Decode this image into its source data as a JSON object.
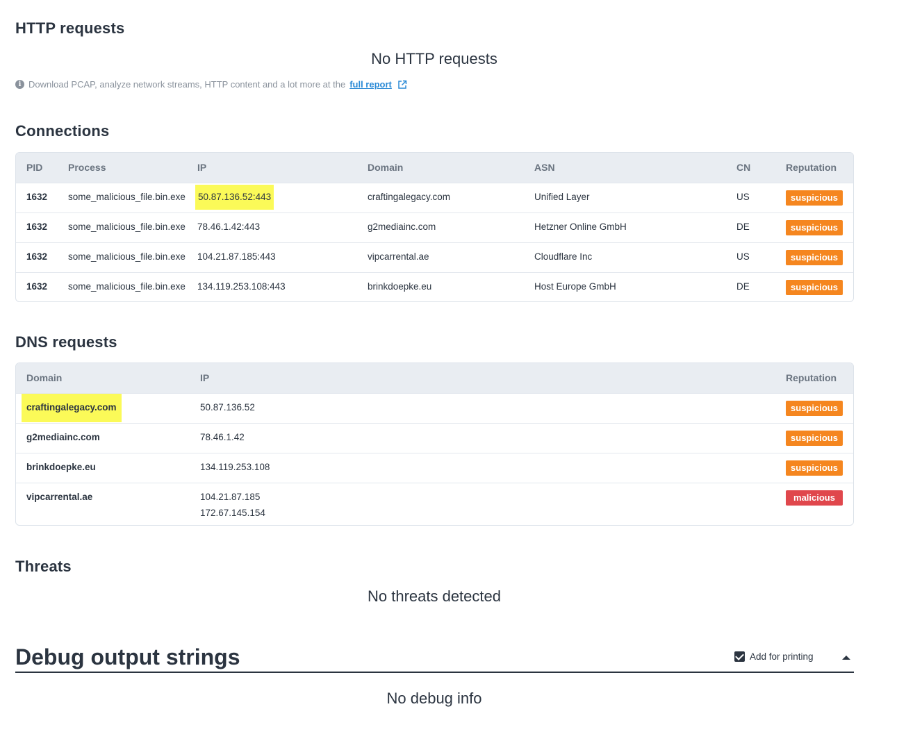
{
  "http": {
    "title": "HTTP requests",
    "empty": "No HTTP requests",
    "info_text": "Download PCAP, analyze network streams, HTTP content and a lot more at the",
    "link_text": "full report"
  },
  "connections": {
    "title": "Connections",
    "headers": [
      "PID",
      "Process",
      "IP",
      "Domain",
      "ASN",
      "CN",
      "Reputation"
    ],
    "rows": [
      {
        "pid": "1632",
        "process": "some_malicious_file.bin.exe",
        "ip": "50.87.136.52:443",
        "domain": "craftingalegacy.com",
        "asn": "Unified Layer",
        "cn": "US",
        "reputation": "suspicious"
      },
      {
        "pid": "1632",
        "process": "some_malicious_file.bin.exe",
        "ip": "78.46.1.42:443",
        "domain": "g2mediainc.com",
        "asn": "Hetzner Online GmbH",
        "cn": "DE",
        "reputation": "suspicious"
      },
      {
        "pid": "1632",
        "process": "some_malicious_file.bin.exe",
        "ip": "104.21.87.185:443",
        "domain": "vipcarrental.ae",
        "asn": "Cloudflare Inc",
        "cn": "US",
        "reputation": "suspicious"
      },
      {
        "pid": "1632",
        "process": "some_malicious_file.bin.exe",
        "ip": "134.119.253.108:443",
        "domain": "brinkdoepke.eu",
        "asn": "Host Europe GmbH",
        "cn": "DE",
        "reputation": "suspicious"
      }
    ]
  },
  "dns": {
    "title": "DNS requests",
    "headers": [
      "Domain",
      "IP",
      "Reputation"
    ],
    "rows": [
      {
        "domain": "craftingalegacy.com",
        "ips": [
          "50.87.136.52"
        ],
        "reputation": "suspicious"
      },
      {
        "domain": "g2mediainc.com",
        "ips": [
          "78.46.1.42"
        ],
        "reputation": "suspicious"
      },
      {
        "domain": "brinkdoepke.eu",
        "ips": [
          "134.119.253.108"
        ],
        "reputation": "suspicious"
      },
      {
        "domain": "vipcarrental.ae",
        "ips": [
          "104.21.87.185",
          "172.67.145.154"
        ],
        "reputation": "malicious"
      }
    ]
  },
  "threats": {
    "title": "Threats",
    "empty": "No threats detected"
  },
  "debug": {
    "title": "Debug output strings",
    "print_label": "Add for printing",
    "empty": "No debug info"
  },
  "colors": {
    "suspicious": "#f5861f",
    "malicious": "#e0474c",
    "highlight": "#fbfa58",
    "link": "#2a8ad6"
  }
}
